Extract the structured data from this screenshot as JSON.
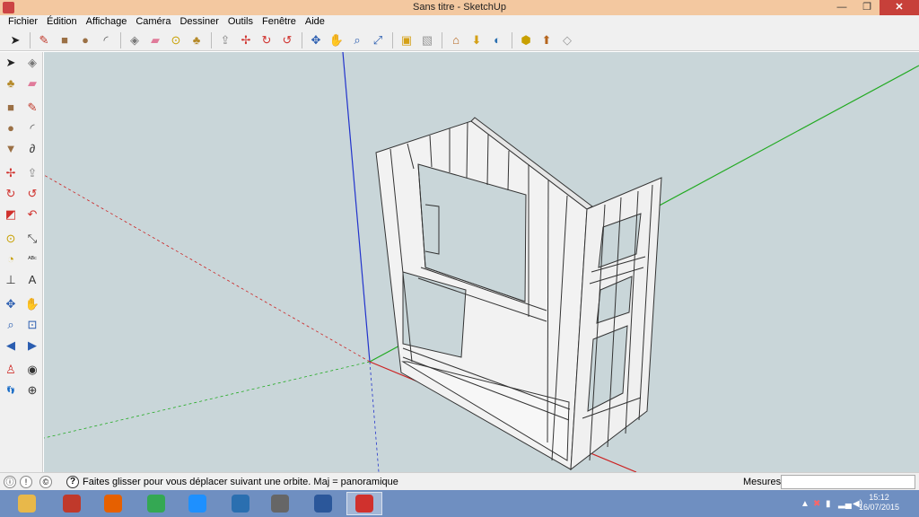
{
  "window": {
    "title": "Sans titre - SketchUp",
    "controls": {
      "minimize": "—",
      "maximize": "❐",
      "close": "✕"
    }
  },
  "menu": [
    "Fichier",
    "Édition",
    "Affichage",
    "Caméra",
    "Dessiner",
    "Outils",
    "Fenêtre",
    "Aide"
  ],
  "toolbar": {
    "groups": [
      [
        {
          "name": "select-icon",
          "glyph": "➤",
          "color": "#222"
        }
      ],
      [
        {
          "name": "line-icon",
          "glyph": "✎",
          "color": "#c0392b"
        },
        {
          "name": "rectangle-icon",
          "glyph": "■",
          "color": "#9b7045"
        },
        {
          "name": "circle-icon",
          "glyph": "●",
          "color": "#9b7045"
        },
        {
          "name": "arc-icon",
          "glyph": "◜",
          "color": "#555"
        }
      ],
      [
        {
          "name": "make-component-icon",
          "glyph": "◈",
          "color": "#777"
        },
        {
          "name": "eraser-icon",
          "glyph": "▰",
          "color": "#e07b9a"
        },
        {
          "name": "tape-measure-icon",
          "glyph": "⊙",
          "color": "#c8a000"
        },
        {
          "name": "paint-bucket-icon",
          "glyph": "♣",
          "color": "#b58a2a"
        }
      ],
      [
        {
          "name": "push-pull-icon",
          "glyph": "⇪",
          "color": "#888"
        },
        {
          "name": "move-icon",
          "glyph": "✢",
          "color": "#d0312d"
        },
        {
          "name": "rotate-icon",
          "glyph": "↻",
          "color": "#d0312d"
        },
        {
          "name": "follow-me-icon",
          "glyph": "↺",
          "color": "#d0312d"
        }
      ],
      [
        {
          "name": "orbit-icon",
          "glyph": "✥",
          "color": "#2a5db0"
        },
        {
          "name": "pan-icon",
          "glyph": "✋",
          "color": "#555"
        },
        {
          "name": "zoom-icon",
          "glyph": "⌕",
          "color": "#2a5db0"
        },
        {
          "name": "zoom-extents-icon",
          "glyph": "⤢",
          "color": "#2a5db0"
        }
      ],
      [
        {
          "name": "add-location-icon",
          "glyph": "▣",
          "color": "#d4a017"
        },
        {
          "name": "share-model-icon",
          "glyph": "▧",
          "color": "#999"
        }
      ],
      [
        {
          "name": "warehouse-icon",
          "glyph": "⌂",
          "color": "#b5651d"
        },
        {
          "name": "components-icon",
          "glyph": "⬇",
          "color": "#d4a017"
        },
        {
          "name": "google-earth-icon",
          "glyph": "◐",
          "color": "#2a6fb0"
        }
      ],
      [
        {
          "name": "extension-warehouse-icon",
          "glyph": "⬢",
          "color": "#c8a000"
        },
        {
          "name": "upload-model-icon",
          "glyph": "⬆",
          "color": "#b5651d"
        },
        {
          "name": "layout-icon",
          "glyph": "◇",
          "color": "#999"
        }
      ]
    ]
  },
  "leftTools": [
    [
      {
        "name": "select-tool-icon",
        "glyph": "➤",
        "color": "#222"
      },
      {
        "name": "component-tool-icon",
        "glyph": "◈",
        "color": "#777"
      }
    ],
    [
      {
        "name": "paint-tool-icon",
        "glyph": "♣",
        "color": "#b58a2a"
      },
      {
        "name": "eraser-tool-icon",
        "glyph": "▰",
        "color": "#e07b9a"
      }
    ],
    "gap",
    [
      {
        "name": "rectangle-tool-icon",
        "glyph": "■",
        "color": "#9b7045"
      },
      {
        "name": "line-tool-icon",
        "glyph": "✎",
        "color": "#c0392b"
      }
    ],
    [
      {
        "name": "circle-tool-icon",
        "glyph": "●",
        "color": "#9b7045"
      },
      {
        "name": "arc-tool-icon",
        "glyph": "◜",
        "color": "#555"
      }
    ],
    [
      {
        "name": "polygon-tool-icon",
        "glyph": "▼",
        "color": "#9b7045"
      },
      {
        "name": "freehand-tool-icon",
        "glyph": "∂",
        "color": "#333"
      }
    ],
    "gap",
    [
      {
        "name": "move-tool-icon",
        "glyph": "✢",
        "color": "#d0312d"
      },
      {
        "name": "push-pull-tool-icon",
        "glyph": "⇪",
        "color": "#888"
      }
    ],
    [
      {
        "name": "rotate-tool-icon",
        "glyph": "↻",
        "color": "#d0312d"
      },
      {
        "name": "follow-me-tool-icon",
        "glyph": "↺",
        "color": "#d0312d"
      }
    ],
    [
      {
        "name": "scale-tool-icon",
        "glyph": "◩",
        "color": "#d0312d"
      },
      {
        "name": "offset-tool-icon",
        "glyph": "↶",
        "color": "#d0312d"
      }
    ],
    "gap",
    [
      {
        "name": "tape-tool-icon",
        "glyph": "⊙",
        "color": "#c8a000"
      },
      {
        "name": "dimension-tool-icon",
        "glyph": "⤡",
        "color": "#333"
      }
    ],
    [
      {
        "name": "protractor-tool-icon",
        "glyph": "◔",
        "color": "#c8a000"
      },
      {
        "name": "text-tool-icon",
        "glyph": "ᴬᴮᶜ",
        "color": "#333"
      }
    ],
    [
      {
        "name": "axes-tool-icon",
        "glyph": "⊥",
        "color": "#333"
      },
      {
        "name": "3d-text-tool-icon",
        "glyph": "A",
        "color": "#333"
      }
    ],
    "gap",
    [
      {
        "name": "orbit-tool-icon",
        "glyph": "✥",
        "color": "#2a5db0"
      },
      {
        "name": "pan-tool-icon",
        "glyph": "✋",
        "color": "#555"
      }
    ],
    [
      {
        "name": "zoom-tool-icon",
        "glyph": "⌕",
        "color": "#2a5db0"
      },
      {
        "name": "zoom-window-tool-icon",
        "glyph": "⊡",
        "color": "#2a5db0"
      }
    ],
    [
      {
        "name": "previous-view-icon",
        "glyph": "◀",
        "color": "#2a5db0"
      },
      {
        "name": "next-view-icon",
        "glyph": "▶",
        "color": "#2a5db0"
      }
    ],
    "gap",
    [
      {
        "name": "position-camera-icon",
        "glyph": "♙",
        "color": "#d0312d"
      },
      {
        "name": "look-around-icon",
        "glyph": "◉",
        "color": "#333"
      }
    ],
    [
      {
        "name": "walk-tool-icon",
        "glyph": "👣",
        "color": "#333"
      },
      {
        "name": "section-plane-icon",
        "glyph": "⊕",
        "color": "#333"
      }
    ]
  ],
  "status": {
    "icons": [
      "ⓘ",
      "!",
      "©"
    ],
    "help": "?",
    "hint": "Faites glisser pour vous déplacer suivant une orbite.  Maj = panoramique",
    "measures_label": "Mesures",
    "measures_value": ""
  },
  "taskbar": {
    "apps": [
      {
        "name": "file-explorer-icon",
        "color": "#e8b84a"
      },
      {
        "name": "power-app-icon",
        "color": "#c0392b"
      },
      {
        "name": "firefox-icon",
        "color": "#e66000"
      },
      {
        "name": "chrome-icon",
        "color": "#34a853"
      },
      {
        "name": "internet-explorer-icon",
        "color": "#1e90ff"
      },
      {
        "name": "settings-app-icon",
        "color": "#2a6fb0"
      },
      {
        "name": "tools-app-icon",
        "color": "#666"
      },
      {
        "name": "word-icon",
        "color": "#2b579a"
      },
      {
        "name": "sketchup-icon",
        "color": "#d0312d"
      }
    ],
    "time": "15:12",
    "date": "16/07/2015"
  },
  "colors": {
    "sky": "#c9d6d9",
    "axis_blue": "#2233cc",
    "axis_green": "#22aa22",
    "axis_red": "#cc2222",
    "taskbar": "#6f8fc1"
  }
}
